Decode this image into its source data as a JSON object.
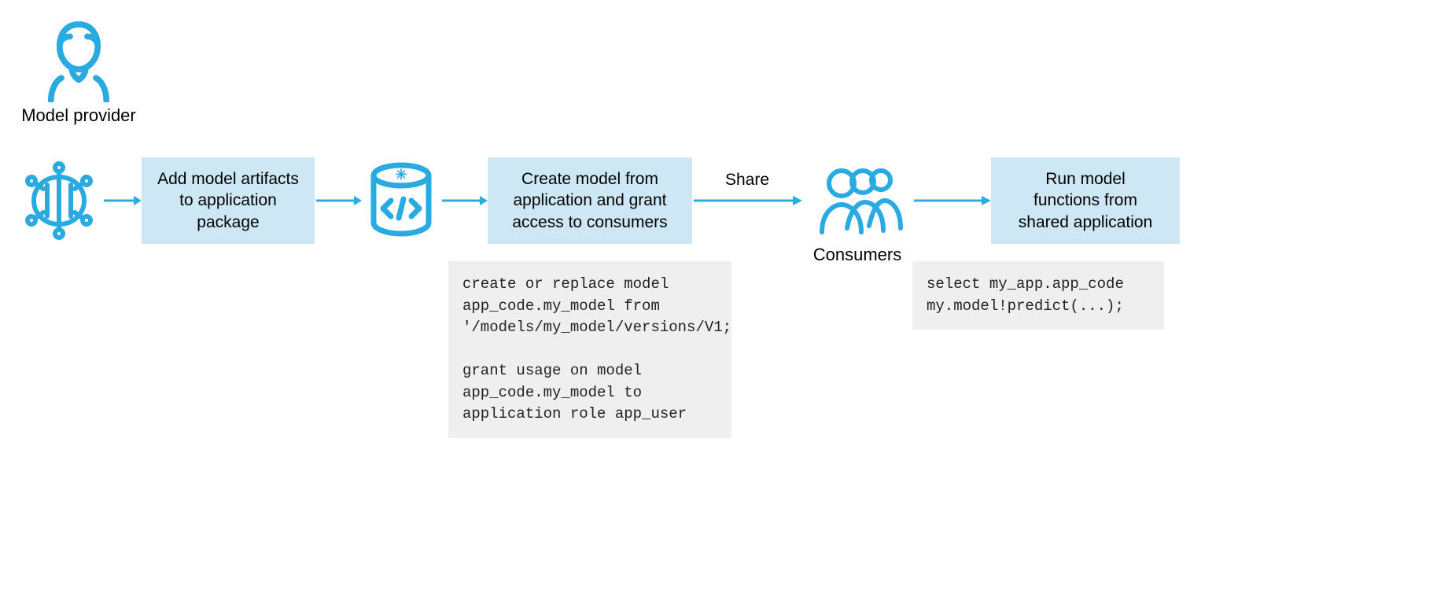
{
  "provider": {
    "label": "Model provider"
  },
  "steps": {
    "add_artifacts": "Add model artifacts\nto application\npackage",
    "create_model": "Create model from\napplication and grant\naccess to consumers",
    "run_model": "Run model\nfunctions from\nshared application"
  },
  "share_label": "Share",
  "consumers_label": "Consumers",
  "code": {
    "create_grant": "create or replace model\napp_code.my_model from\n'/models/my_model/versions/V1;\n\ngrant usage on model\napp_code.my_model to\napplication role app_user",
    "run": "select my_app.app_code\nmy.model!predict(...);"
  },
  "colors": {
    "accent": "#29abe2",
    "box": "#cde8f4",
    "code_bg": "#efefef"
  }
}
